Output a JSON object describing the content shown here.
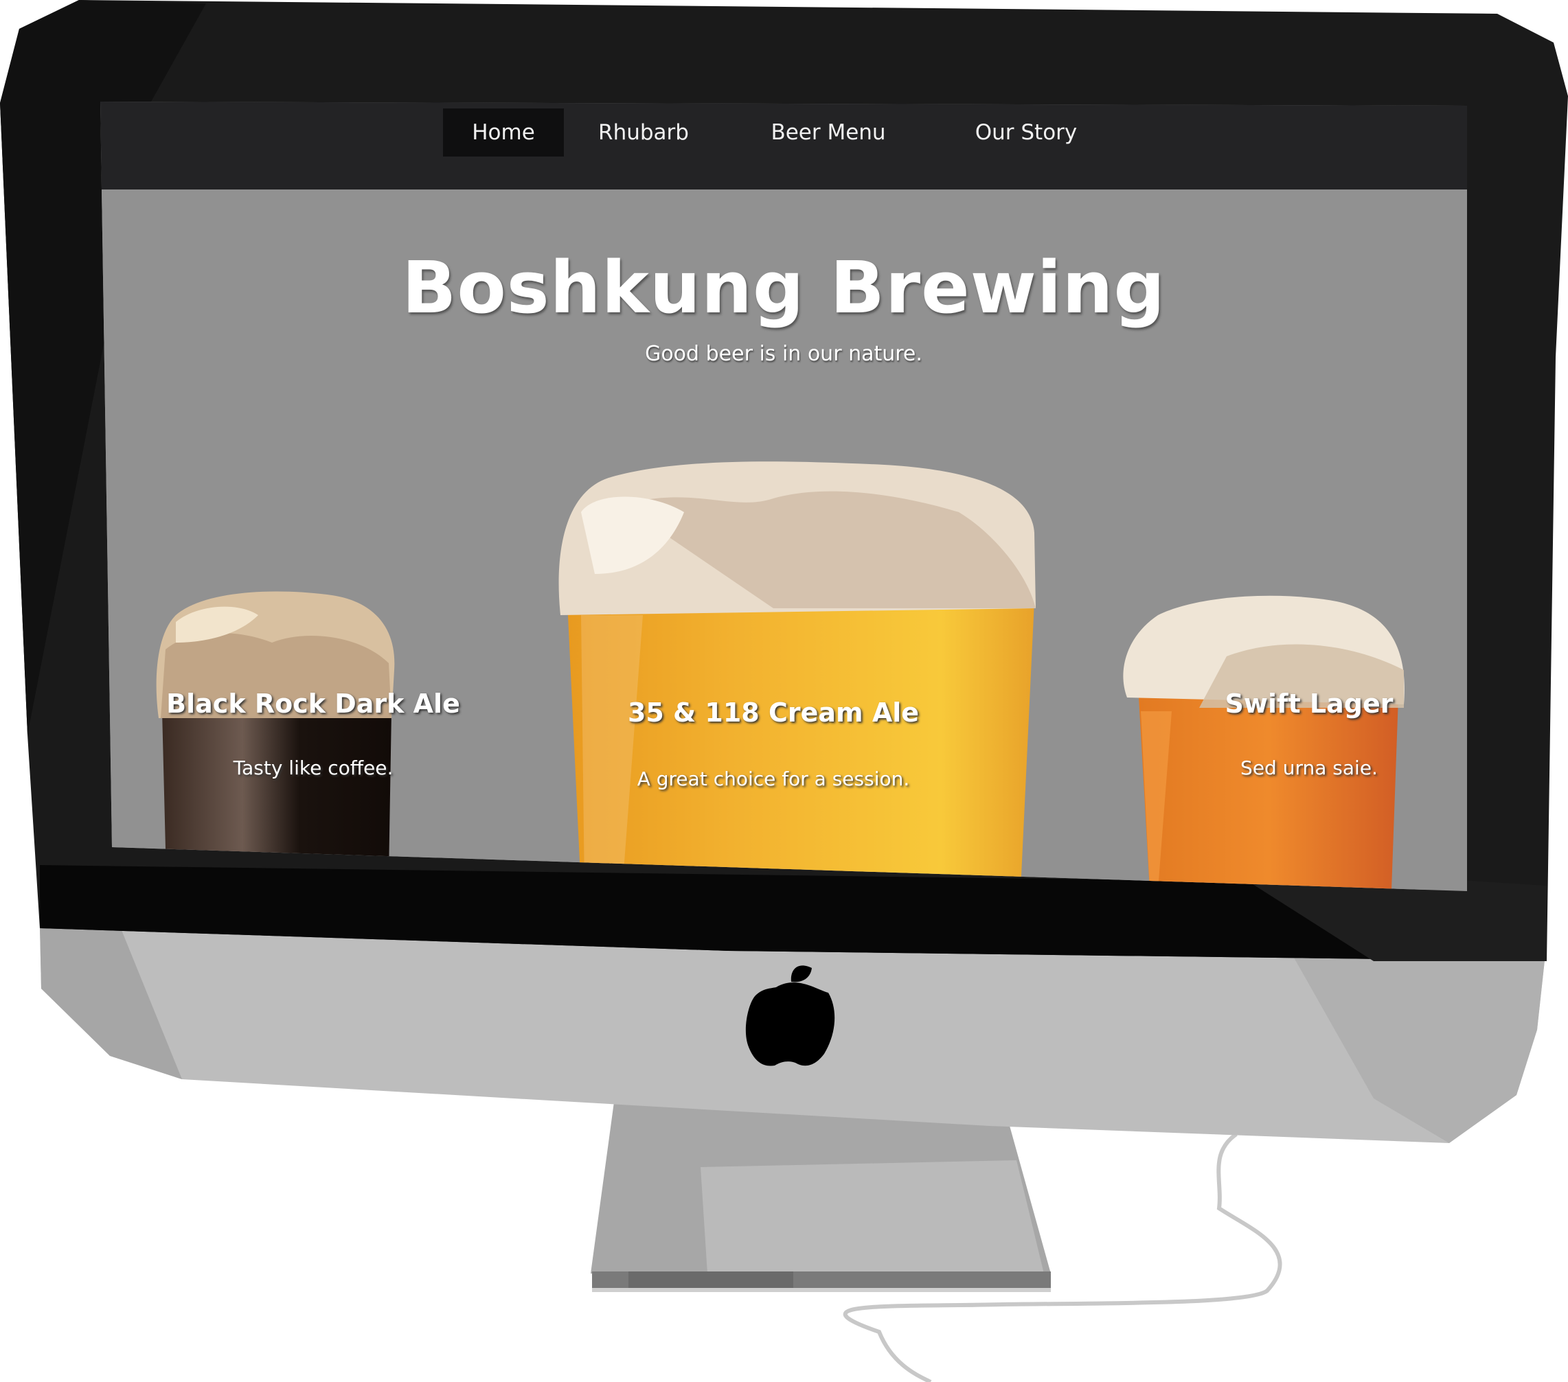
{
  "nav": {
    "items": [
      {
        "label": "Home",
        "active": true
      },
      {
        "label": "Rhubarb",
        "active": false
      },
      {
        "label": "Beer Menu",
        "active": false
      },
      {
        "label": "Our Story",
        "active": false
      }
    ]
  },
  "hero": {
    "title": "Boshkung Brewing",
    "tagline": "Good beer is in our nature."
  },
  "beers": [
    {
      "name": "Black Rock Dark Ale",
      "description": "Tasty like coffee."
    },
    {
      "name": "35 & 118 Cream Ale",
      "description": "A great choice for a session."
    },
    {
      "name": "Swift Lager",
      "description": "Sed urna saie."
    }
  ],
  "colors": {
    "nav_bg": "#232325",
    "nav_active_bg": "#0f0f10",
    "hero_bg": "#919191",
    "bezel": "#1a1a1a",
    "chin": "#bdbdbd",
    "dark_ale": "#2a1d16",
    "cream_ale": "#f0a628",
    "lager": "#e07628",
    "foam": "#efe5d6"
  },
  "icons": [
    "apple-logo-icon",
    "camera-icon"
  ]
}
